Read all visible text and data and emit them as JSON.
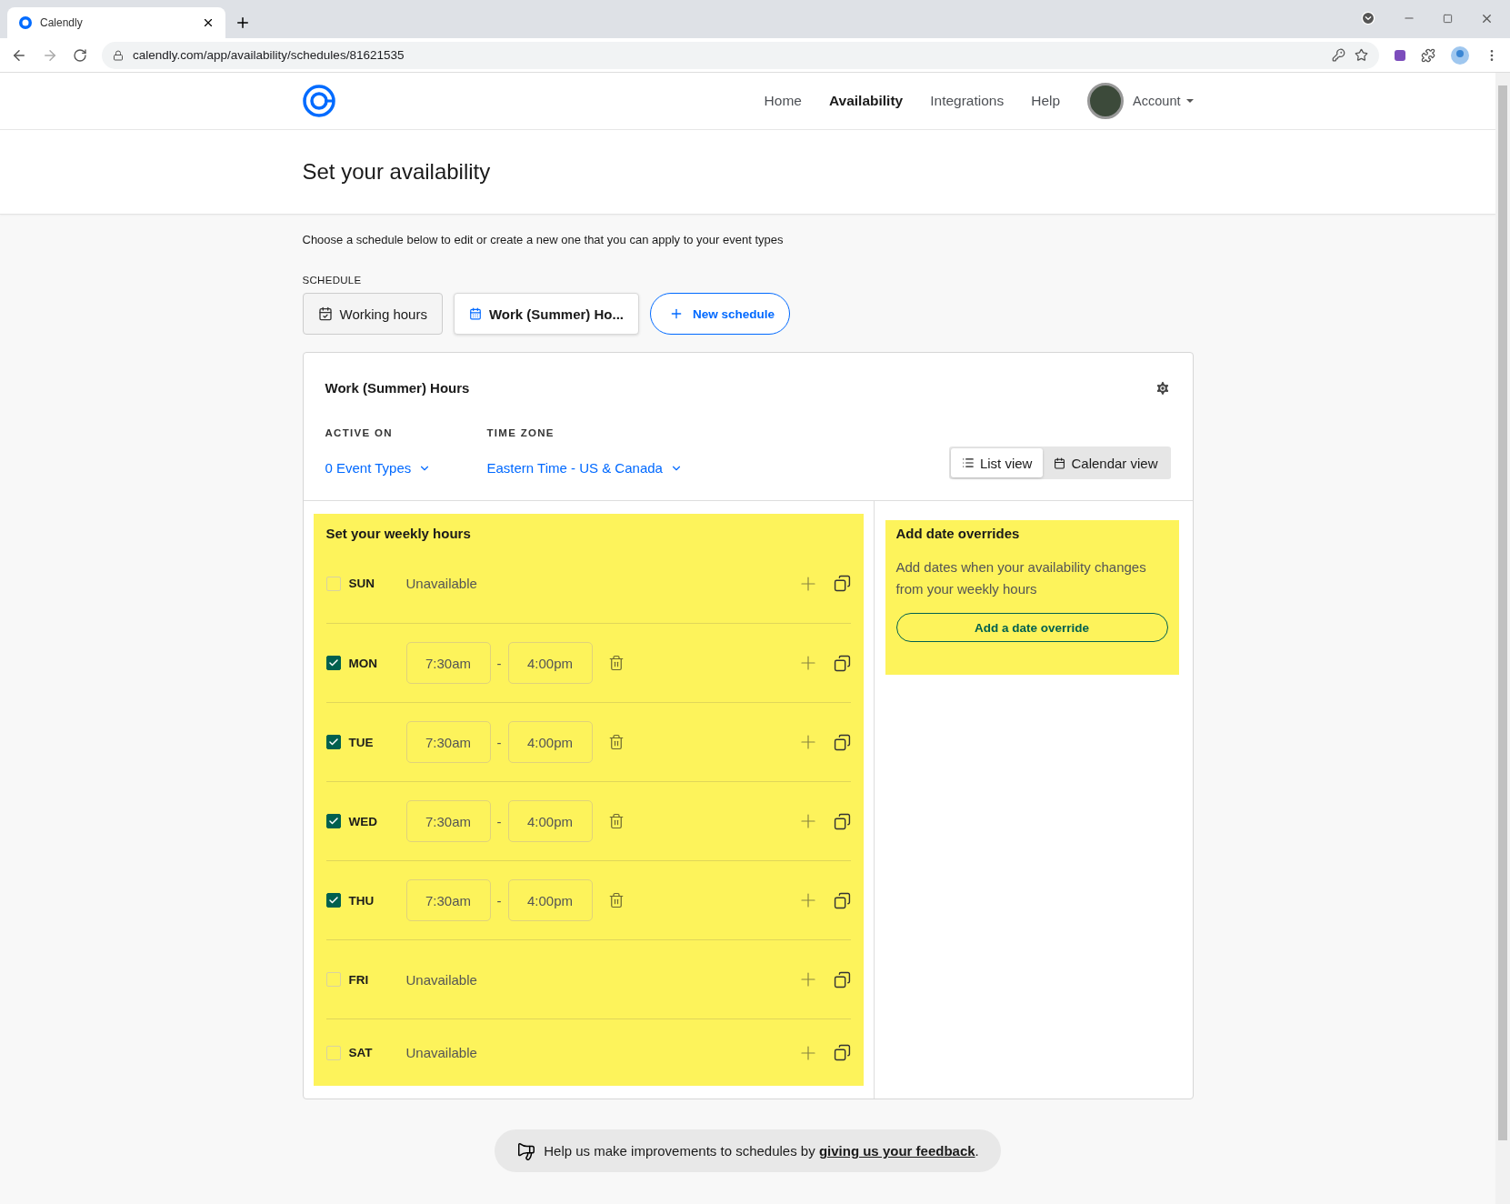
{
  "browser": {
    "tab_title": "Calendly",
    "url": "calendly.com/app/availability/schedules/81621535"
  },
  "nav": {
    "items": [
      {
        "label": "Home",
        "selected": false
      },
      {
        "label": "Availability",
        "selected": true
      },
      {
        "label": "Integrations",
        "selected": false
      },
      {
        "label": "Help",
        "selected": false
      }
    ],
    "account": "Account"
  },
  "page_title": "Set your availability",
  "intro": "Choose a schedule below to edit or create a new one that you can apply to your event types",
  "schedule_label": "SCHEDULE",
  "schedules": [
    {
      "label": "Working hours",
      "selected": false
    },
    {
      "label": "Work (Summer) Ho...",
      "selected": true
    }
  ],
  "new_schedule": "New schedule",
  "card": {
    "title": "Work (Summer) Hours",
    "active_on_label": "ACTIVE ON",
    "active_on": "0 Event Types",
    "time_zone_label": "TIME ZONE",
    "time_zone": "Eastern Time - US & Canada",
    "views": [
      {
        "label": "List view",
        "selected": true
      },
      {
        "label": "Calendar view",
        "selected": false
      }
    ]
  },
  "weekly": {
    "title": "Set your weekly hours",
    "days": [
      {
        "day": "SUN",
        "checked": false,
        "status": "Unavailable"
      },
      {
        "day": "MON",
        "checked": true,
        "start": "7:30am",
        "separator": "-",
        "end": "4:00pm"
      },
      {
        "day": "TUE",
        "checked": true,
        "start": "7:30am",
        "separator": "-",
        "end": "4:00pm"
      },
      {
        "day": "WED",
        "checked": true,
        "start": "7:30am",
        "separator": "-",
        "end": "4:00pm"
      },
      {
        "day": "THU",
        "checked": true,
        "start": "7:30am",
        "separator": "-",
        "end": "4:00pm"
      },
      {
        "day": "FRI",
        "checked": false,
        "status": "Unavailable"
      },
      {
        "day": "SAT",
        "checked": false,
        "status": "Unavailable"
      }
    ]
  },
  "overrides": {
    "title": "Add date overrides",
    "text": "Add dates when your availability changes from your weekly hours",
    "button": "Add a date override"
  },
  "feedback": {
    "text": "Help us make improvements to schedules by ",
    "link": "giving us your feedback",
    "end": "."
  }
}
